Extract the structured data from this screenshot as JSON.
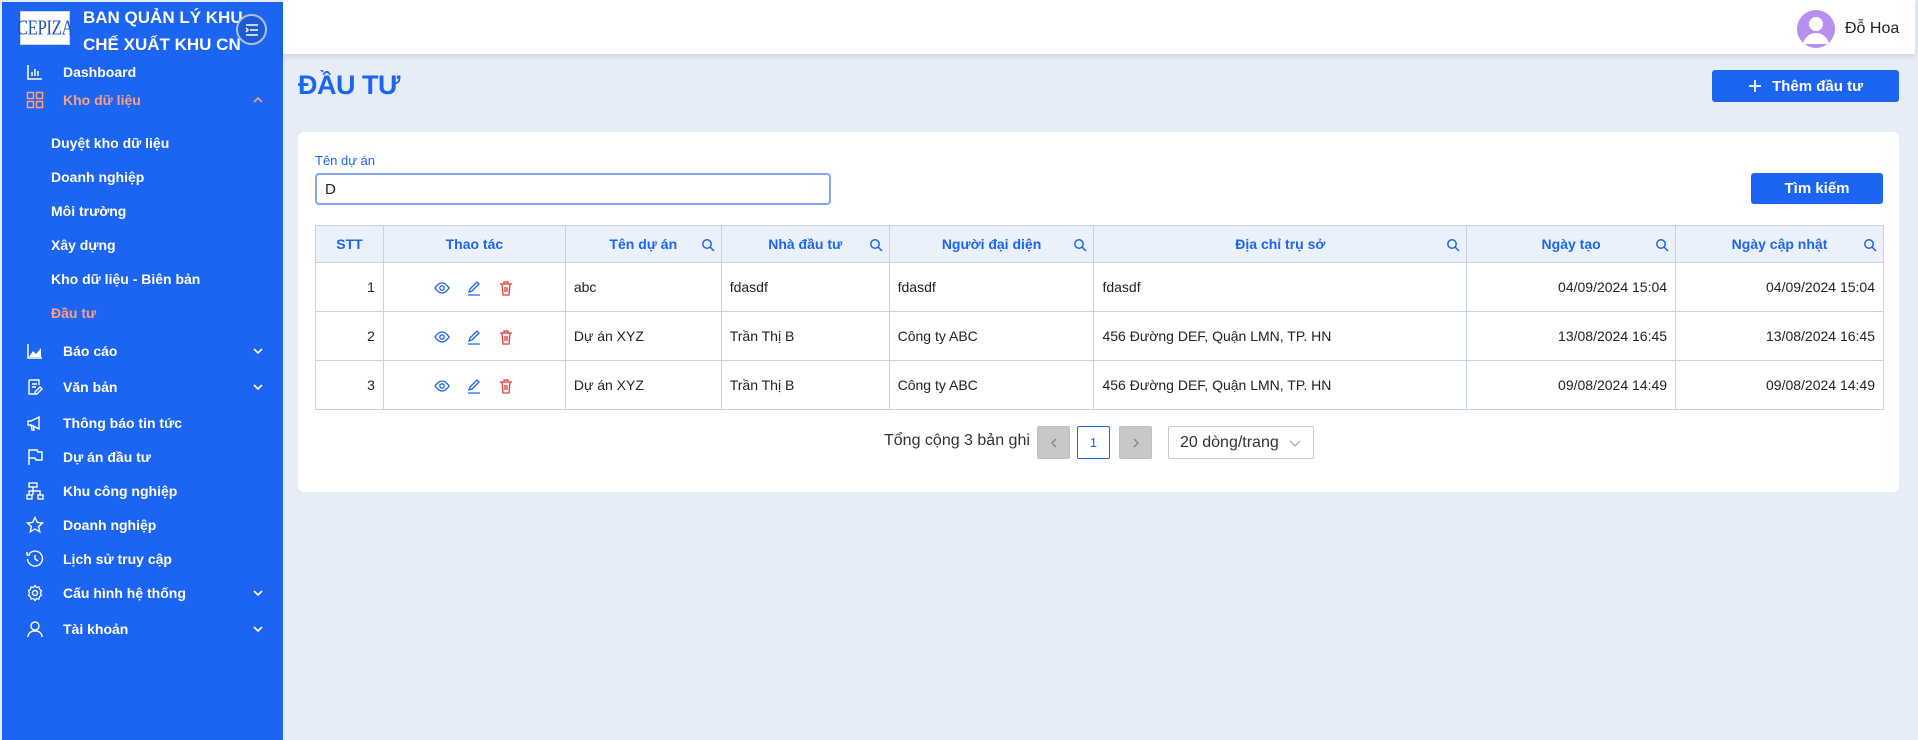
{
  "brand": {
    "logo_text": "CEPIZA",
    "title_line1": "BAN QUẢN LÝ KHU",
    "title_line2": "CHẾ XUẤT KHU CN"
  },
  "sidebar": {
    "items": [
      {
        "label": "Dashboard",
        "icon": "chart-bar-icon"
      },
      {
        "label": "Kho dữ liệu",
        "icon": "grid-icon",
        "expanded": true
      },
      {
        "label": "Báo cáo",
        "icon": "area-chart-icon"
      },
      {
        "label": "Văn bản",
        "icon": "document-edit-icon"
      },
      {
        "label": "Thông báo tin tức",
        "icon": "megaphone-icon"
      },
      {
        "label": "Dự án đầu tư",
        "icon": "flag-icon"
      },
      {
        "label": "Khu công nghiệp",
        "icon": "sitemap-icon"
      },
      {
        "label": "Doanh nghiệp",
        "icon": "star-icon"
      },
      {
        "label": "Lịch sử truy cập",
        "icon": "clock-icon"
      },
      {
        "label": "Cấu hình hệ thống",
        "icon": "gear-icon"
      },
      {
        "label": "Tài khoản",
        "icon": "user-icon"
      }
    ],
    "subitems": [
      {
        "label": "Duyệt kho dữ liệu"
      },
      {
        "label": "Doanh nghiệp"
      },
      {
        "label": "Môi trường"
      },
      {
        "label": "Xây dựng"
      },
      {
        "label": "Kho dữ liệu - Biên bản"
      },
      {
        "label": "Đầu tư",
        "active": true
      }
    ]
  },
  "header": {
    "username": "Đỗ Hoa"
  },
  "page": {
    "title": "ĐẦU TƯ",
    "add_label": "Thêm đầu tư"
  },
  "filter": {
    "label": "Tên dự án",
    "value": "D",
    "search_label": "Tìm kiếm"
  },
  "table": {
    "columns": [
      "STT",
      "Thao tác",
      "Tên dự án",
      "Nhà đầu tư",
      "Người đại diện",
      "Địa chỉ trụ sở",
      "Ngày tạo",
      "Ngày cập nhật"
    ],
    "rows": [
      [
        "1",
        "",
        "abc",
        "fdasdf",
        "fdasdf",
        "fdasdf",
        "04/09/2024 15:04",
        "04/09/2024 15:04"
      ],
      [
        "2",
        "",
        "Dự án XYZ",
        "Trần Thị B",
        "Công ty ABC",
        "456 Đường DEF, Quận LMN, TP. HN",
        "13/08/2024 16:45",
        "13/08/2024 16:45"
      ],
      [
        "3",
        "",
        "Dự án XYZ",
        "Trần Thị B",
        "Công ty ABC",
        "456 Đường DEF, Quận LMN, TP. HN",
        "09/08/2024 14:49",
        "09/08/2024 14:49"
      ]
    ]
  },
  "pagination": {
    "total_text": "Tổng cộng 3 bản ghi",
    "current_page": "1",
    "page_size": "20 dòng/trang"
  },
  "colors": {
    "primary": "#1c64f2",
    "active_menu": "#ffa07a",
    "delete": "#e53935",
    "background": "#e6edf6"
  }
}
